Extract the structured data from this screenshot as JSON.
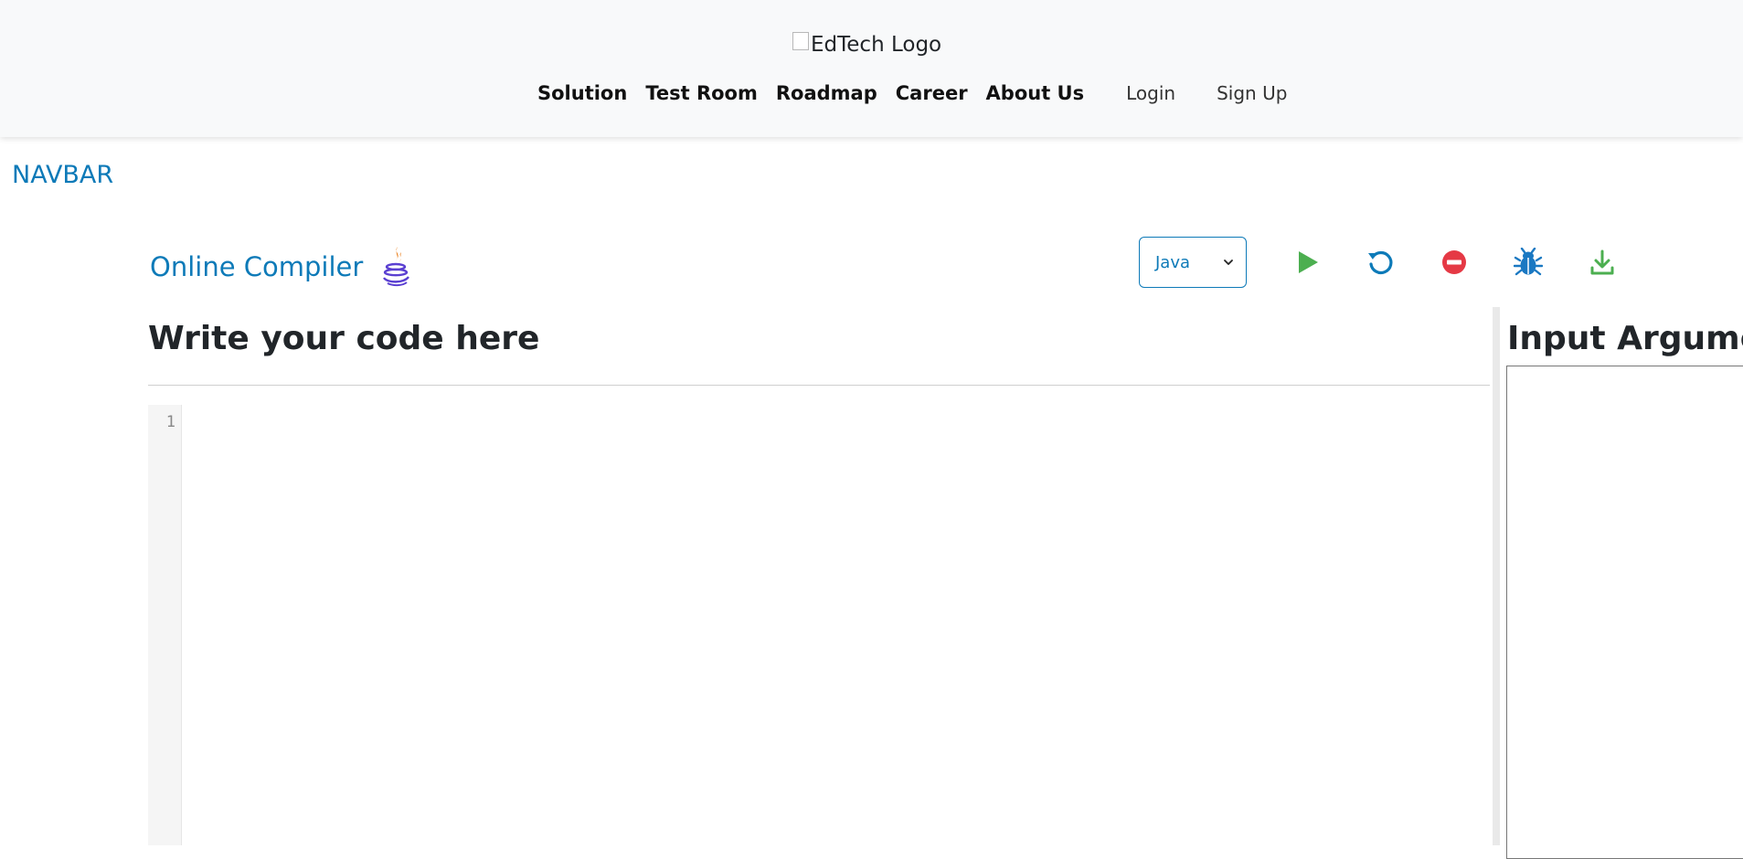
{
  "header": {
    "logo_alt": "EdTech Logo",
    "nav": [
      "Solution",
      "Test Room",
      "Roadmap",
      "Career",
      "About Us"
    ],
    "login": "Login",
    "signup": "Sign Up"
  },
  "navbar_label": "NAVBAR",
  "compiler": {
    "title": "Online Compiler",
    "language_icon": "java-icon",
    "language_selected": "Java",
    "toolbar": [
      {
        "name": "run-icon",
        "color": "#4caf50"
      },
      {
        "name": "reset-icon",
        "color": "#0d7ab8"
      },
      {
        "name": "stop-icon",
        "color": "#e53945"
      },
      {
        "name": "debug-icon",
        "color": "#1a78c2"
      },
      {
        "name": "download-icon",
        "color": "#4caf50"
      }
    ]
  },
  "editor": {
    "heading": "Write your code here",
    "line_numbers": [
      "1"
    ]
  },
  "input_panel": {
    "heading": "Input Arguments"
  },
  "colors": {
    "accent": "#0d7ab8",
    "header_bg": "#f8f9fa"
  }
}
